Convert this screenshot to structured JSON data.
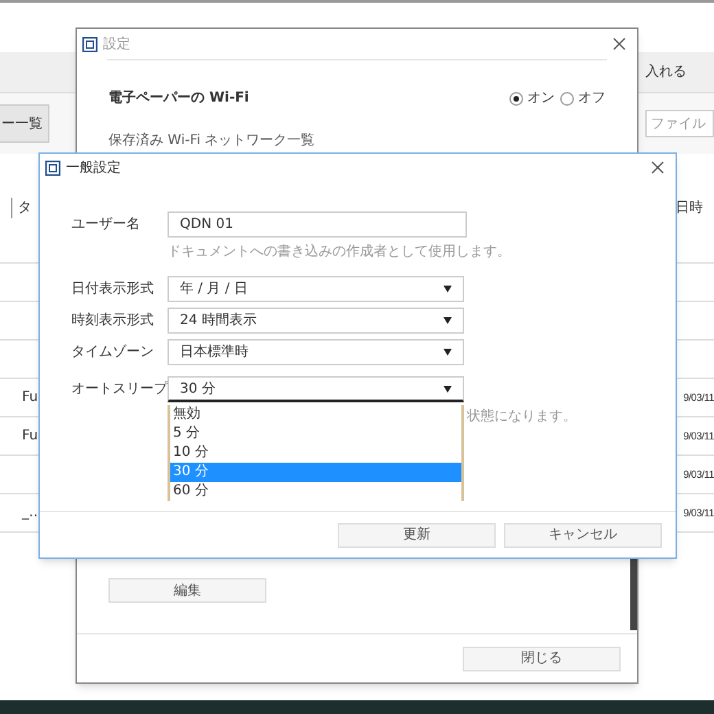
{
  "background_app": {
    "toolbar_button": "ー一覧",
    "toolbar_action": "入れる",
    "search": {
      "placeholder": "ファイル"
    },
    "table": {
      "columns": [
        "タ",
        "日時"
      ],
      "rows": [
        {
          "column_1": "Fu",
          "date": "9/03/11"
        },
        {
          "column_1": "Fu",
          "date": "9/03/11"
        },
        {
          "date": "9/03/11"
        },
        {
          "column_1": "_…",
          "date": "9/03/11"
        }
      ]
    }
  },
  "settings_window": {
    "title": "設定",
    "wifi_label": "電子ペーパーの Wi-Fi",
    "wifi_options": [
      {
        "label": "オン",
        "selected": true
      },
      {
        "label": "オフ",
        "selected": false
      }
    ],
    "saved_networks_label": "保存済み Wi-Fi ネットワーク一覧",
    "edit_button": "編集",
    "close_button": "閉じる"
  },
  "general_dialog": {
    "title": "一般設定",
    "fields": [
      {
        "kind": "text",
        "label": "ユーザー名",
        "value": "QDN 01",
        "hint": "ドキュメントへの書き込みの作成者として使用します。"
      },
      {
        "kind": "select",
        "label": "日付表示形式",
        "value": "年 / 月 / 日"
      },
      {
        "kind": "select",
        "label": "時刻表示形式",
        "value": "24 時間表示"
      },
      {
        "kind": "select",
        "label": "タイムゾーン",
        "value": "日本標準時"
      },
      {
        "kind": "select",
        "label": "オートスリープ",
        "value": "30 分",
        "open": true,
        "hint": "状態になります。",
        "options": [
          {
            "label": "無効",
            "selected": false
          },
          {
            "label": "5 分",
            "selected": false
          },
          {
            "label": "10 分",
            "selected": false
          },
          {
            "label": "30 分",
            "selected": true
          },
          {
            "label": "60 分",
            "selected": false
          }
        ]
      }
    ],
    "buttons": [
      "更新",
      "キャンセル"
    ]
  }
}
